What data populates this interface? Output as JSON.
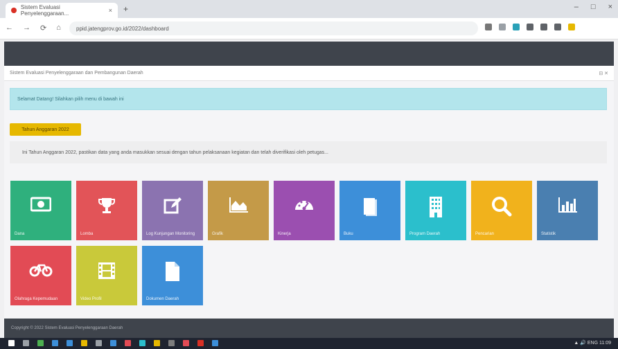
{
  "browser": {
    "tab_title": "Sistem Evaluasi Penyelenggaraan...",
    "tab_close": "×",
    "new_tab": "+",
    "url": "ppid.jatengprov.go.id/2022/dashboard",
    "nav": [
      "←",
      "→",
      "⟳",
      "⌂"
    ],
    "window_controls": [
      "–",
      "□",
      "×"
    ],
    "extension_colors": [
      "#777777",
      "#9aa0a6",
      "#2aa1b8",
      "#5f6368",
      "#5f6368",
      "#5f6368",
      "#e6b800"
    ]
  },
  "panel": {
    "title": "Sistem Evaluasi Penyelenggaraan dan Pembangunan Daerah",
    "controls": "⊟ ✕"
  },
  "alert_text": "Selamat Datang! Silahkan pilih menu di bawah ini",
  "year_button": "Tahun Anggaran 2022",
  "notice_text": "Ini Tahun Anggaran 2022, pastikan data yang anda masukkan sesuai dengan tahun pelaksanaan kegiatan dan telah diverifikasi oleh petugas...",
  "tiles": [
    {
      "label": "Dana",
      "icon": "money-icon",
      "color": "#2fb07d"
    },
    {
      "label": "Lomba",
      "icon": "trophy-icon",
      "color": "#e25458"
    },
    {
      "label": "Log Kunjungan Monitoring",
      "icon": "edit-icon",
      "color": "#8b73b0"
    },
    {
      "label": "Grafik",
      "icon": "area-chart-icon",
      "color": "#c49a48"
    },
    {
      "label": "Kinerja",
      "icon": "dashboard-icon",
      "color": "#9b4fb0"
    },
    {
      "label": "Buku",
      "icon": "book-icon",
      "color": "#3d8fd9"
    },
    {
      "label": "Program Daerah",
      "icon": "building-icon",
      "color": "#2bbfcc"
    },
    {
      "label": "Pencarian",
      "icon": "search-icon",
      "color": "#f1b21c"
    },
    {
      "label": "Statistik",
      "icon": "bar-chart-icon",
      "color": "#4a7fb0"
    },
    {
      "label": "Olahraga Kepemudaan",
      "icon": "bicycle-icon",
      "color": "#e24b55"
    },
    {
      "label": "Video Profil",
      "icon": "film-icon",
      "color": "#c9c93a"
    },
    {
      "label": "Dokumen Daerah",
      "icon": "document-icon",
      "color": "#3d8fd9"
    }
  ],
  "footer_text": "Copyright © 2022 Sistem Evaluasi Penyelenggaraan Daerah",
  "taskbar": {
    "icon_colors": [
      "#ffffff",
      "#9aa0a6",
      "#4caf50",
      "#3d8fd9",
      "#3d8fd9",
      "#e6b800",
      "#9aa0a6",
      "#3d8fd9",
      "#e24b55",
      "#2bbfcc",
      "#e6b800",
      "#7d7d7d",
      "#e24b55",
      "#d93025",
      "#3d8fd9"
    ],
    "tray": "▲ 🔊 ENG 11:09"
  }
}
